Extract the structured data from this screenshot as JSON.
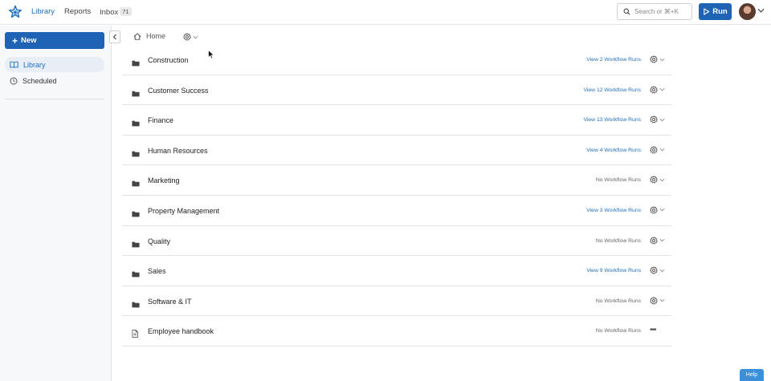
{
  "topbar": {
    "nav": [
      {
        "label": "Library",
        "active": true
      },
      {
        "label": "Reports",
        "active": false
      },
      {
        "label": "Inbox",
        "active": false
      }
    ],
    "inbox_count": "71",
    "search_placeholder": "Search or ⌘+K",
    "run_label": "Run",
    "accent": "#1f63b5"
  },
  "sidebar": {
    "new_label": "New",
    "items": [
      {
        "label": "Library",
        "icon": "book-icon",
        "active": true
      },
      {
        "label": "Scheduled",
        "icon": "clock-icon",
        "active": false
      }
    ]
  },
  "breadcrumb": {
    "home_label": "Home"
  },
  "rows": [
    {
      "name": "Construction",
      "runs": "View 2 Workflow Runs",
      "type": "folder"
    },
    {
      "name": "Customer Success",
      "runs": "View 12 Workflow Runs",
      "type": "folder"
    },
    {
      "name": "Finance",
      "runs": "View 13 Workflow Runs",
      "type": "folder"
    },
    {
      "name": "Human Resources",
      "runs": "View 4 Workflow Runs",
      "type": "folder"
    },
    {
      "name": "Marketing",
      "runs": "No Workflow Runs",
      "type": "folder"
    },
    {
      "name": "Property Management",
      "runs": "View 3 Workflow Runs",
      "type": "folder"
    },
    {
      "name": "Quality",
      "runs": "No Workflow Runs",
      "type": "folder"
    },
    {
      "name": "Sales",
      "runs": "View 9 Workflow Runs",
      "type": "folder"
    },
    {
      "name": "Software & IT",
      "runs": "No Workflow Runs",
      "type": "folder"
    },
    {
      "name": "Employee handbook",
      "runs": "No Workflow Runs",
      "type": "document"
    }
  ],
  "help_label": "Help"
}
